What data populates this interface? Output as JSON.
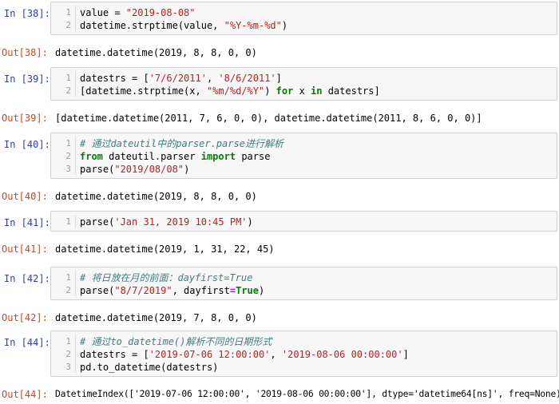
{
  "cells": [
    {
      "in_prompt": "In [38]:",
      "out_prompt": "Out[38]:",
      "lines": [
        {
          "n": "1",
          "parts": [
            {
              "t": "value = ",
              "c": ""
            },
            {
              "t": "\"2019-08-08\"",
              "c": "str"
            }
          ]
        },
        {
          "n": "2",
          "parts": [
            {
              "t": "datetime.strptime(value, ",
              "c": ""
            },
            {
              "t": "\"%Y-%m-%d\"",
              "c": "str"
            },
            {
              "t": ")",
              "c": ""
            }
          ]
        }
      ],
      "output": "datetime.datetime(2019, 8, 8, 0, 0)"
    },
    {
      "in_prompt": "In [39]:",
      "out_prompt": "Out[39]:",
      "lines": [
        {
          "n": "1",
          "parts": [
            {
              "t": "datestrs = [",
              "c": ""
            },
            {
              "t": "'7/6/2011'",
              "c": "str"
            },
            {
              "t": ", ",
              "c": ""
            },
            {
              "t": "'8/6/2011'",
              "c": "str"
            },
            {
              "t": "]",
              "c": ""
            }
          ]
        },
        {
          "n": "2",
          "parts": [
            {
              "t": "[datetime.strptime(x, ",
              "c": ""
            },
            {
              "t": "\"%m/%d/%Y\"",
              "c": "str"
            },
            {
              "t": ") ",
              "c": ""
            },
            {
              "t": "for",
              "c": "kw"
            },
            {
              "t": " x ",
              "c": ""
            },
            {
              "t": "in",
              "c": "kw"
            },
            {
              "t": " datestrs]",
              "c": ""
            }
          ]
        }
      ],
      "output": "[datetime.datetime(2011, 7, 6, 0, 0), datetime.datetime(2011, 8, 6, 0, 0)]"
    },
    {
      "in_prompt": "In [40]:",
      "out_prompt": "Out[40]:",
      "lines": [
        {
          "n": "1",
          "parts": [
            {
              "t": "# 通过dateutil中的parser.parse进行解析",
              "c": "cm"
            }
          ]
        },
        {
          "n": "2",
          "parts": [
            {
              "t": "from",
              "c": "kw"
            },
            {
              "t": " dateutil.parser ",
              "c": ""
            },
            {
              "t": "import",
              "c": "kw"
            },
            {
              "t": " parse",
              "c": ""
            }
          ]
        },
        {
          "n": "3",
          "parts": [
            {
              "t": "parse(",
              "c": ""
            },
            {
              "t": "\"2019/08/08\"",
              "c": "str"
            },
            {
              "t": ")",
              "c": ""
            }
          ]
        }
      ],
      "output": "datetime.datetime(2019, 8, 8, 0, 0)"
    },
    {
      "in_prompt": "In [41]:",
      "out_prompt": "Out[41]:",
      "lines": [
        {
          "n": "1",
          "parts": [
            {
              "t": "parse(",
              "c": ""
            },
            {
              "t": "'Jan 31, 2019 10:45 PM'",
              "c": "str"
            },
            {
              "t": ")",
              "c": ""
            }
          ]
        }
      ],
      "output": "datetime.datetime(2019, 1, 31, 22, 45)"
    },
    {
      "in_prompt": "In [42]:",
      "out_prompt": "Out[42]:",
      "lines": [
        {
          "n": "1",
          "parts": [
            {
              "t": "# 将日放在月的前面：dayfirst=True",
              "c": "cm"
            }
          ]
        },
        {
          "n": "2",
          "parts": [
            {
              "t": "parse(",
              "c": ""
            },
            {
              "t": "\"8/7/2019\"",
              "c": "str"
            },
            {
              "t": ", dayfirst",
              "c": ""
            },
            {
              "t": "=",
              "c": "op"
            },
            {
              "t": "True",
              "c": "kw"
            },
            {
              "t": ")",
              "c": ""
            }
          ]
        }
      ],
      "output": "datetime.datetime(2019, 7, 8, 0, 0)"
    },
    {
      "in_prompt": "In [44]:",
      "out_prompt": "Out[44]:",
      "lines": [
        {
          "n": "1",
          "parts": [
            {
              "t": "# 通过to_datetime()解析不同的日期形式",
              "c": "cm"
            }
          ]
        },
        {
          "n": "2",
          "parts": [
            {
              "t": "datestrs = [",
              "c": ""
            },
            {
              "t": "'2019-07-06 12:00:00'",
              "c": "str"
            },
            {
              "t": ", ",
              "c": ""
            },
            {
              "t": "'2019-08-06 00:00:00'",
              "c": "str"
            },
            {
              "t": "]",
              "c": ""
            }
          ]
        },
        {
          "n": "3",
          "parts": [
            {
              "t": "pd.to_datetime(datestrs)",
              "c": ""
            }
          ]
        }
      ],
      "output": "DatetimeIndex(['2019-07-06 12:00:00', '2019-08-06 00:00:00'], dtype='datetime64[ns]', freq=None)"
    }
  ]
}
